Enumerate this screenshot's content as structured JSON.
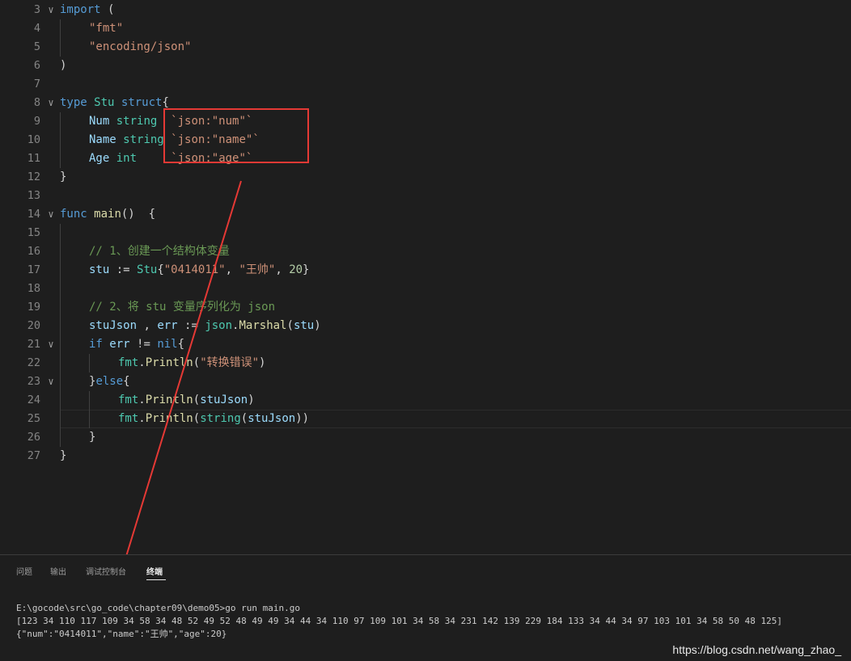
{
  "editor": {
    "lines": [
      {
        "n": "3",
        "fold": true,
        "indent": 0,
        "segs": [
          {
            "t": "import",
            "c": "k"
          },
          {
            "t": " (",
            "c": "p"
          }
        ]
      },
      {
        "n": "4",
        "indent": 1,
        "segs": [
          {
            "t": "\"fmt\"",
            "c": "s"
          }
        ]
      },
      {
        "n": "5",
        "indent": 1,
        "segs": [
          {
            "t": "\"encoding/json\"",
            "c": "s"
          }
        ]
      },
      {
        "n": "6",
        "indent": 0,
        "segs": [
          {
            "t": ")",
            "c": "p"
          }
        ]
      },
      {
        "n": "7",
        "indent": 0,
        "segs": []
      },
      {
        "n": "8",
        "fold": true,
        "indent": 0,
        "segs": [
          {
            "t": "type",
            "c": "k"
          },
          {
            "t": " ",
            "c": "p"
          },
          {
            "t": "Stu",
            "c": "t"
          },
          {
            "t": " ",
            "c": "p"
          },
          {
            "t": "struct",
            "c": "k"
          },
          {
            "t": "{",
            "c": "p"
          }
        ]
      },
      {
        "n": "9",
        "indent": 1,
        "segs": [
          {
            "t": "Num",
            "c": "v"
          },
          {
            "t": " ",
            "c": "p"
          },
          {
            "t": "string",
            "c": "t"
          },
          {
            "t": "  ",
            "c": "p"
          },
          {
            "t": "`json:\"num\"`",
            "c": "s"
          }
        ]
      },
      {
        "n": "10",
        "indent": 1,
        "segs": [
          {
            "t": "Name",
            "c": "v"
          },
          {
            "t": " ",
            "c": "p"
          },
          {
            "t": "string",
            "c": "t"
          },
          {
            "t": " ",
            "c": "p"
          },
          {
            "t": "`json:\"name\"`",
            "c": "s"
          }
        ]
      },
      {
        "n": "11",
        "indent": 1,
        "segs": [
          {
            "t": "Age",
            "c": "v"
          },
          {
            "t": " ",
            "c": "p"
          },
          {
            "t": "int",
            "c": "t"
          },
          {
            "t": "     ",
            "c": "p"
          },
          {
            "t": "`json:\"age\"`",
            "c": "s"
          }
        ]
      },
      {
        "n": "12",
        "indent": 0,
        "segs": [
          {
            "t": "}",
            "c": "p"
          }
        ]
      },
      {
        "n": "13",
        "indent": 0,
        "segs": []
      },
      {
        "n": "14",
        "fold": true,
        "indent": 0,
        "segs": [
          {
            "t": "func",
            "c": "k"
          },
          {
            "t": " ",
            "c": "p"
          },
          {
            "t": "main",
            "c": "f"
          },
          {
            "t": "()  {",
            "c": "p"
          }
        ]
      },
      {
        "n": "15",
        "indent": 1,
        "segs": []
      },
      {
        "n": "16",
        "indent": 1,
        "segs": [
          {
            "t": "// 1、创建一个结构体变量",
            "c": "c"
          }
        ]
      },
      {
        "n": "17",
        "indent": 1,
        "segs": [
          {
            "t": "stu",
            "c": "v"
          },
          {
            "t": " := ",
            "c": "p"
          },
          {
            "t": "Stu",
            "c": "t"
          },
          {
            "t": "{",
            "c": "p"
          },
          {
            "t": "\"0414011\"",
            "c": "s"
          },
          {
            "t": ", ",
            "c": "p"
          },
          {
            "t": "\"王帅\"",
            "c": "s"
          },
          {
            "t": ", ",
            "c": "p"
          },
          {
            "t": "20",
            "c": "n"
          },
          {
            "t": "}",
            "c": "p"
          }
        ]
      },
      {
        "n": "18",
        "indent": 1,
        "segs": []
      },
      {
        "n": "19",
        "indent": 1,
        "segs": [
          {
            "t": "// 2、将 stu 变量序列化为 json",
            "c": "c"
          }
        ]
      },
      {
        "n": "20",
        "indent": 1,
        "segs": [
          {
            "t": "stuJson",
            "c": "v"
          },
          {
            "t": " , ",
            "c": "p"
          },
          {
            "t": "err",
            "c": "v"
          },
          {
            "t": " := ",
            "c": "p"
          },
          {
            "t": "json",
            "c": "t"
          },
          {
            "t": ".",
            "c": "p"
          },
          {
            "t": "Marshal",
            "c": "f"
          },
          {
            "t": "(",
            "c": "p"
          },
          {
            "t": "stu",
            "c": "v"
          },
          {
            "t": ")",
            "c": "p"
          }
        ]
      },
      {
        "n": "21",
        "fold": true,
        "indent": 1,
        "segs": [
          {
            "t": "if",
            "c": "k"
          },
          {
            "t": " ",
            "c": "p"
          },
          {
            "t": "err",
            "c": "v"
          },
          {
            "t": " != ",
            "c": "p"
          },
          {
            "t": "nil",
            "c": "k"
          },
          {
            "t": "{",
            "c": "p"
          }
        ]
      },
      {
        "n": "22",
        "indent": 2,
        "segs": [
          {
            "t": "fmt",
            "c": "t"
          },
          {
            "t": ".",
            "c": "p"
          },
          {
            "t": "Println",
            "c": "f"
          },
          {
            "t": "(",
            "c": "p"
          },
          {
            "t": "\"转换错误\"",
            "c": "s"
          },
          {
            "t": ")",
            "c": "p"
          }
        ]
      },
      {
        "n": "23",
        "fold": true,
        "indent": 1,
        "segs": [
          {
            "t": "}",
            "c": "p"
          },
          {
            "t": "else",
            "c": "k"
          },
          {
            "t": "{",
            "c": "p"
          }
        ]
      },
      {
        "n": "24",
        "indent": 2,
        "segs": [
          {
            "t": "fmt",
            "c": "t"
          },
          {
            "t": ".",
            "c": "p"
          },
          {
            "t": "Println",
            "c": "f"
          },
          {
            "t": "(",
            "c": "p"
          },
          {
            "t": "stuJson",
            "c": "v"
          },
          {
            "t": ")",
            "c": "p"
          }
        ]
      },
      {
        "n": "25",
        "indent": 2,
        "segs": [
          {
            "t": "fmt",
            "c": "t"
          },
          {
            "t": ".",
            "c": "p"
          },
          {
            "t": "Println",
            "c": "f"
          },
          {
            "t": "(",
            "c": "p"
          },
          {
            "t": "string",
            "c": "t"
          },
          {
            "t": "(",
            "c": "p"
          },
          {
            "t": "stuJson",
            "c": "v"
          },
          {
            "t": "))",
            "c": "p"
          }
        ]
      },
      {
        "n": "26",
        "indent": 1,
        "segs": [
          {
            "t": "}",
            "c": "p"
          }
        ]
      },
      {
        "n": "27",
        "indent": 0,
        "segs": [
          {
            "t": "}",
            "c": "p"
          }
        ]
      }
    ]
  },
  "panel": {
    "tabs": [
      {
        "label": "问题",
        "active": false
      },
      {
        "label": "输出",
        "active": false
      },
      {
        "label": "调试控制台",
        "active": false
      },
      {
        "label": "终端",
        "active": true
      }
    ],
    "terminal": [
      "E:\\gocode\\src\\go_code\\chapter09\\demo05>go run main.go",
      "[123 34 110 117 109 34 58 34 48 52 49 52 48 49 49 34 44 34 110 97 109 101 34 58 34 231 142 139 229 184 133 34 44 34 97 103 101 34 58 50 48 125]",
      "{\"num\":\"0414011\",\"name\":\"王帅\",\"age\":20}"
    ]
  },
  "watermark": "https://blog.csdn.net/wang_zhao_",
  "colors": {
    "keyword": "#569cd6",
    "string": "#ce9178",
    "type": "#4ec9b0",
    "function": "#dcdcaa",
    "variable": "#9cdcfe",
    "number": "#b5cea8",
    "comment": "#6a9955",
    "annotation": "#e53935"
  }
}
